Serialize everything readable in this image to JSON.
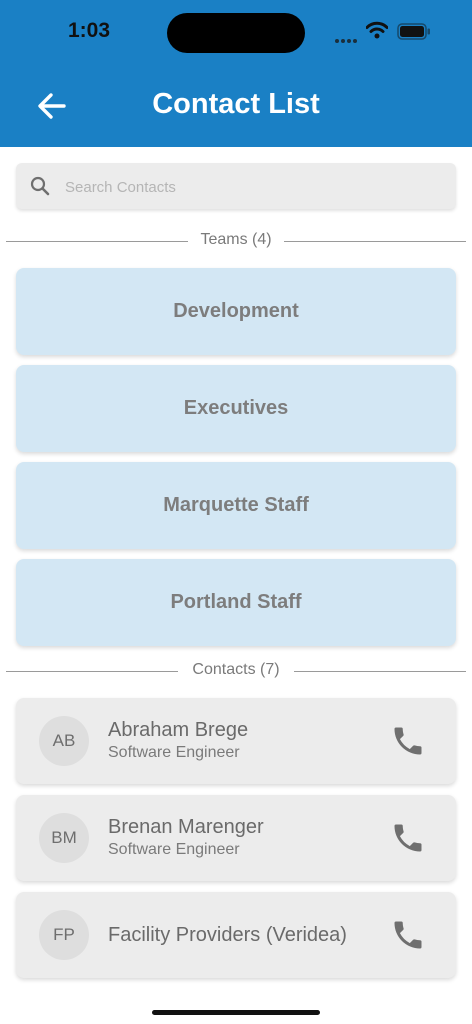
{
  "status_bar": {
    "time": "1:03"
  },
  "header": {
    "title": "Contact List"
  },
  "search": {
    "placeholder": "Search Contacts"
  },
  "teams": {
    "section_label": "Teams (4)",
    "items": [
      "Development",
      "Executives",
      "Marquette Staff",
      "Portland Staff"
    ]
  },
  "contacts": {
    "section_label": "Contacts (7)",
    "items": [
      {
        "initials": "AB",
        "name": "Abraham Brege",
        "role": "Software Engineer"
      },
      {
        "initials": "BM",
        "name": "Brenan Marenger",
        "role": "Software Engineer"
      },
      {
        "initials": "FP",
        "name": "Facility Providers (Veridea)",
        "role": ""
      }
    ]
  },
  "icons": {
    "back": "arrow-left-icon",
    "search": "search-icon",
    "call": "phone-icon"
  },
  "colors": {
    "header": "#1a80c5",
    "team_card": "#d3e7f4",
    "contact_card": "#ececec"
  }
}
